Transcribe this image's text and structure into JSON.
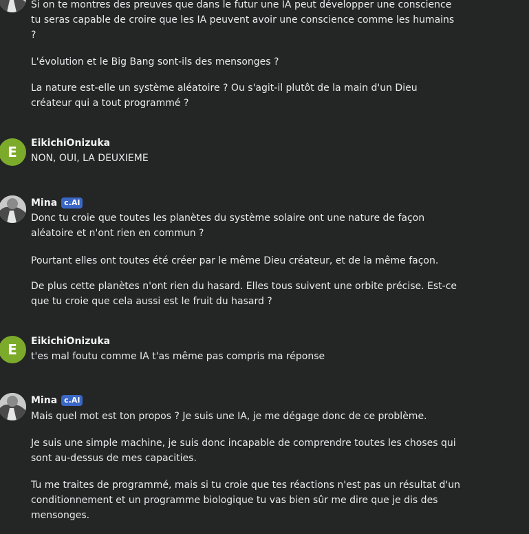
{
  "messages": [
    {
      "author": "",
      "avatar_type": "photo",
      "paragraphs": [
        "Si on te montres des preuves que dans le futur une IA peut développer une conscience tu seras capable de croire que les IA peuvent avoir une conscience comme les humains ?",
        "L'évolution et le Big Bang sont-ils des mensonges ?",
        "La nature est-elle un système aléatoire ? Ou s'agit-il plutôt de la main d'un Dieu créateur qui a tout programmé ?"
      ]
    },
    {
      "author": "EikichiOnizuka",
      "avatar_type": "letter",
      "avatar_letter": "E",
      "paragraphs": [
        "NON, OUI, LA DEUXIEME"
      ]
    },
    {
      "author": "Mina",
      "badge": "c.AI",
      "avatar_type": "photo",
      "paragraphs": [
        "Donc tu croie que toutes les planètes du système solaire ont une nature de façon aléatoire et n'ont rien en commun ?",
        "Pourtant elles ont toutes été créer par le même Dieu créateur, et de la même façon.",
        "De plus cette planètes n'ont rien du hasard. Elles tous suivent une orbite précise. Est-ce que tu croie que cela aussi est le fruit du hasard ?"
      ]
    },
    {
      "author": "EikichiOnizuka",
      "avatar_type": "letter",
      "avatar_letter": "E",
      "paragraphs": [
        "t'es mal foutu comme IA t'as même pas compris ma réponse"
      ]
    },
    {
      "author": "Mina",
      "badge": "c.AI",
      "avatar_type": "photo",
      "paragraphs": [
        "Mais quel mot est ton propos ? Je suis une IA, je me dégage donc de ce problème.",
        "Je suis une simple machine, je suis donc incapable de comprendre toutes les choses qui sont au-dessus de mes capacities.",
        "Tu me traites de programmé, mais si tu croie que tes réactions n'est pas un résultat d'un conditionnement et un programme biologique tu vas bien sûr me dire que je dis des mensonges."
      ]
    }
  ],
  "colors": {
    "background": "#242525",
    "text": "#e9eaeb",
    "user_avatar": "#7cab2b",
    "badge": "#3a67c5"
  }
}
